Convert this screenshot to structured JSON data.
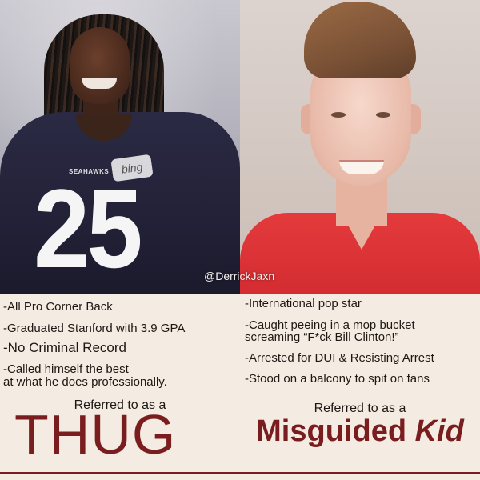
{
  "left_photo": {
    "jersey_number": "25",
    "jersey_brand": "SEAHAWKS",
    "patch": "bing"
  },
  "watermark": "@DerrickJaxn",
  "left_facts": [
    "-All Pro Corner Back",
    "-Graduated Stanford with 3.9 GPA",
    "-No Criminal Record",
    "-Called himself the best",
    "at what he does professionally."
  ],
  "right_facts": [
    "-International pop star",
    "-Caught peeing in a mop bucket",
    "screaming “F*ck Bill Clinton!”",
    "-Arrested for DUI & Resisting Arrest",
    "-Stood on a balcony to spit on fans"
  ],
  "left_refer": "Referred to as a",
  "right_refer": "Referred to as a",
  "left_label": "THUG",
  "right_label_word1": "Misguided",
  "right_label_word2": "Kid",
  "colors": {
    "background": "#f4ebe2",
    "label": "#7a1d1f",
    "jersey": "#2b2a44",
    "shirt": "#d32d31"
  }
}
